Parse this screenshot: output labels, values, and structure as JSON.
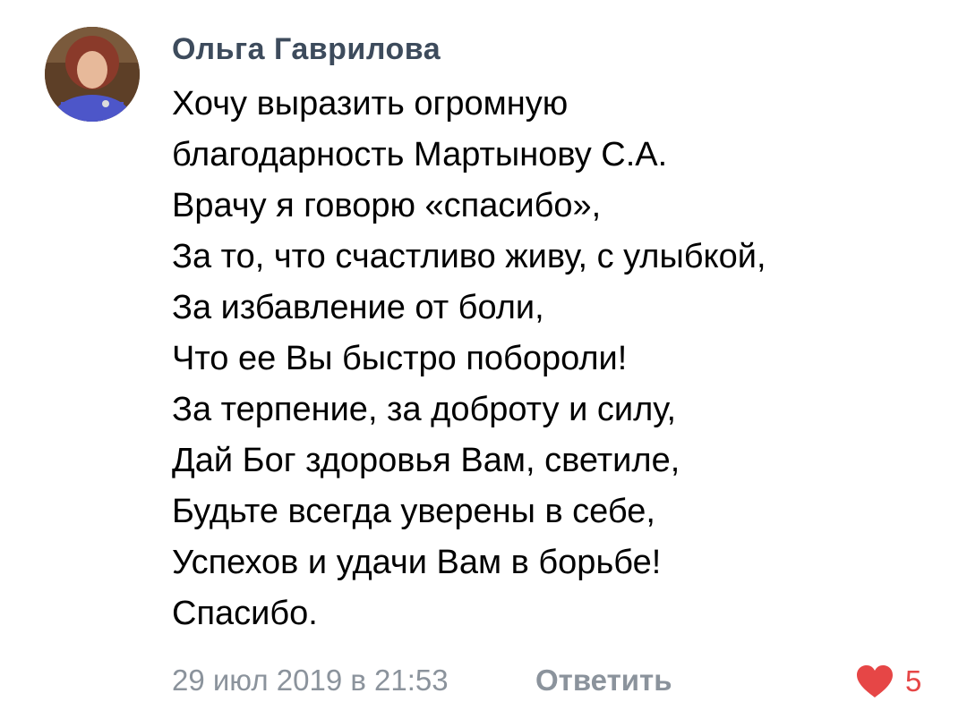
{
  "comment": {
    "author": "Ольга Гаврилова",
    "lines": [
      "Хочу выразить огромную",
      "благодарность Мартынову С.А.",
      "Врачу я говорю «спасибо»,",
      "За то, что счастливо живу, с улыбкой,",
      "За избавление от боли,",
      "Что ее Вы быстро побороли!",
      "За терпение, за доброту и силу,",
      "Дай Бог здоровья Вам, светиле,",
      "Будьте всегда уверены в себе,",
      "Успехов и удачи Вам в борьбе!",
      "Спасибо."
    ],
    "timestamp": "29 июл 2019 в 21:53",
    "reply_label": "Ответить",
    "likes_count": "5"
  },
  "icons": {
    "avatar": "user-photo",
    "like": "heart-icon"
  },
  "colors": {
    "author": "#3d4b5c",
    "text": "#000000",
    "meta": "#8b939c",
    "like": "#e64646",
    "background": "#ffffff"
  }
}
